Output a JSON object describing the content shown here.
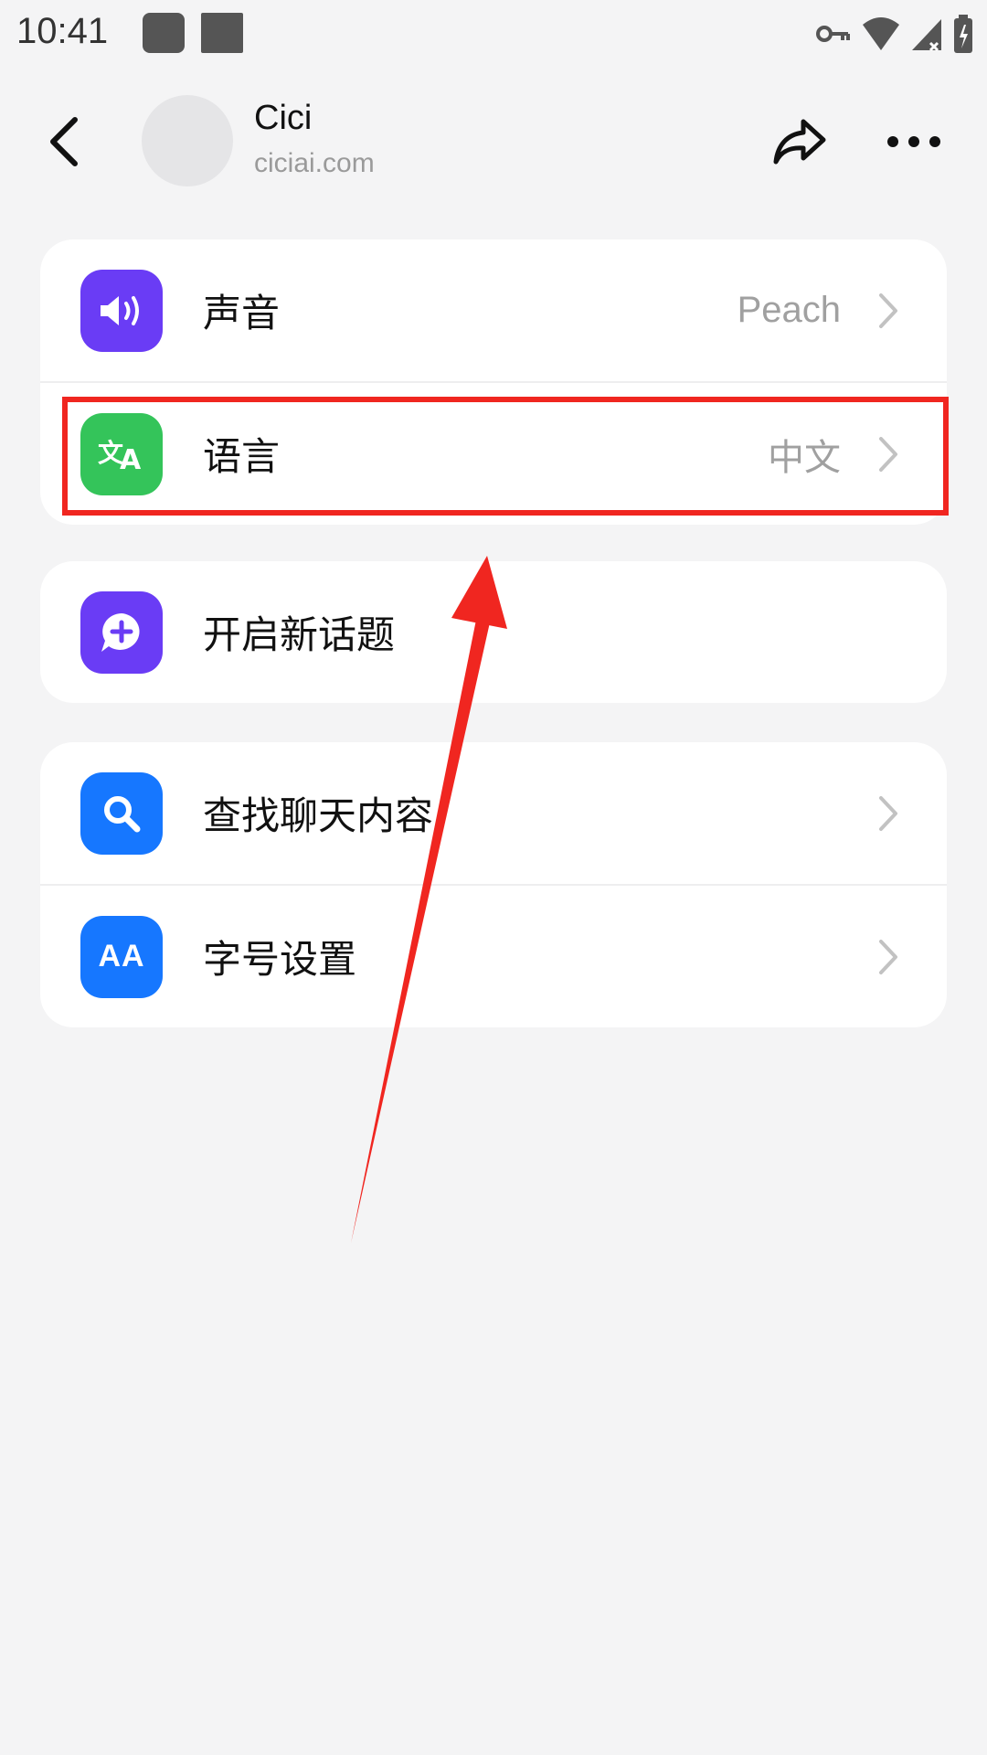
{
  "status_bar": {
    "time": "10:41",
    "icons": [
      "app-square-icon",
      "app-square-icon",
      "vpn-key-icon",
      "wifi-icon",
      "signal-icon",
      "battery-icon"
    ]
  },
  "header": {
    "name": "Cici",
    "subtitle": "ciciai.com",
    "icons": [
      "back-arrow-icon",
      "share-icon",
      "more-icon"
    ]
  },
  "colors": {
    "background": "#f4f4f5",
    "voice_icon_bg": "#6a3cf5",
    "language_icon_bg": "#34c45a",
    "new_topic_icon_bg": "#6a3cf5",
    "search_icon_bg": "#1677ff",
    "font_size_icon_bg": "#1677ff",
    "annotation_red": "#f02620"
  },
  "sections": [
    {
      "items": [
        {
          "label": "声音",
          "value": "Peach",
          "icon": "speaker-icon"
        },
        {
          "label": "语言",
          "value": "中文",
          "icon": "translate-icon"
        }
      ]
    },
    {
      "items": [
        {
          "label": "开启新话题",
          "icon": "chat-plus-icon"
        }
      ]
    },
    {
      "items": [
        {
          "label": "查找聊天内容",
          "icon": "search-icon"
        },
        {
          "label": "字号设置",
          "icon": "font-size-icon"
        }
      ]
    }
  ],
  "icon_text": {
    "font_size": "AA"
  }
}
